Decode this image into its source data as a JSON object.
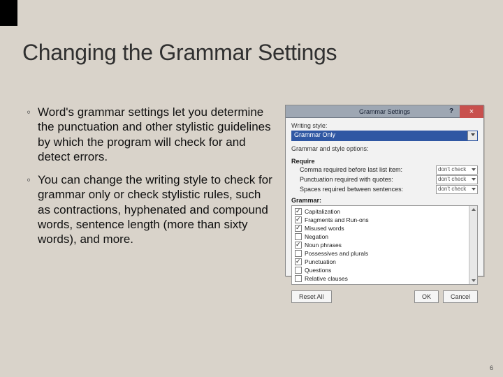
{
  "slide": {
    "title": "Changing the Grammar Settings",
    "bullets": [
      "Word's grammar settings let you determine the punctuation and other stylistic guidelines by which the program will check for and detect errors.",
      "You can change the writing style to check for grammar only or check stylistic rules, such as contractions, hyphenated and compound words, sentence length (more than sixty words), and more."
    ],
    "page_number": "6"
  },
  "dialog": {
    "title": "Grammar Settings",
    "help_glyph": "?",
    "close_glyph": "×",
    "writing_style_label": "Writing style:",
    "writing_style_value": "Grammar Only",
    "options_label": "Grammar and style options:",
    "require_heading": "Require",
    "require_rows": [
      {
        "label": "Comma required before last list item:",
        "value": "don't check"
      },
      {
        "label": "Punctuation required with quotes:",
        "value": "don't check"
      },
      {
        "label": "Spaces required between sentences:",
        "value": "don't check"
      }
    ],
    "grammar_heading": "Grammar:",
    "grammar_items": [
      {
        "label": "Capitalization",
        "checked": true
      },
      {
        "label": "Fragments and Run-ons",
        "checked": true
      },
      {
        "label": "Misused words",
        "checked": true
      },
      {
        "label": "Negation",
        "checked": false
      },
      {
        "label": "Noun phrases",
        "checked": true
      },
      {
        "label": "Possessives and plurals",
        "checked": false
      },
      {
        "label": "Punctuation",
        "checked": true
      },
      {
        "label": "Questions",
        "checked": false
      },
      {
        "label": "Relative clauses",
        "checked": false
      }
    ],
    "buttons": {
      "reset": "Reset All",
      "ok": "OK",
      "cancel": "Cancel"
    }
  }
}
